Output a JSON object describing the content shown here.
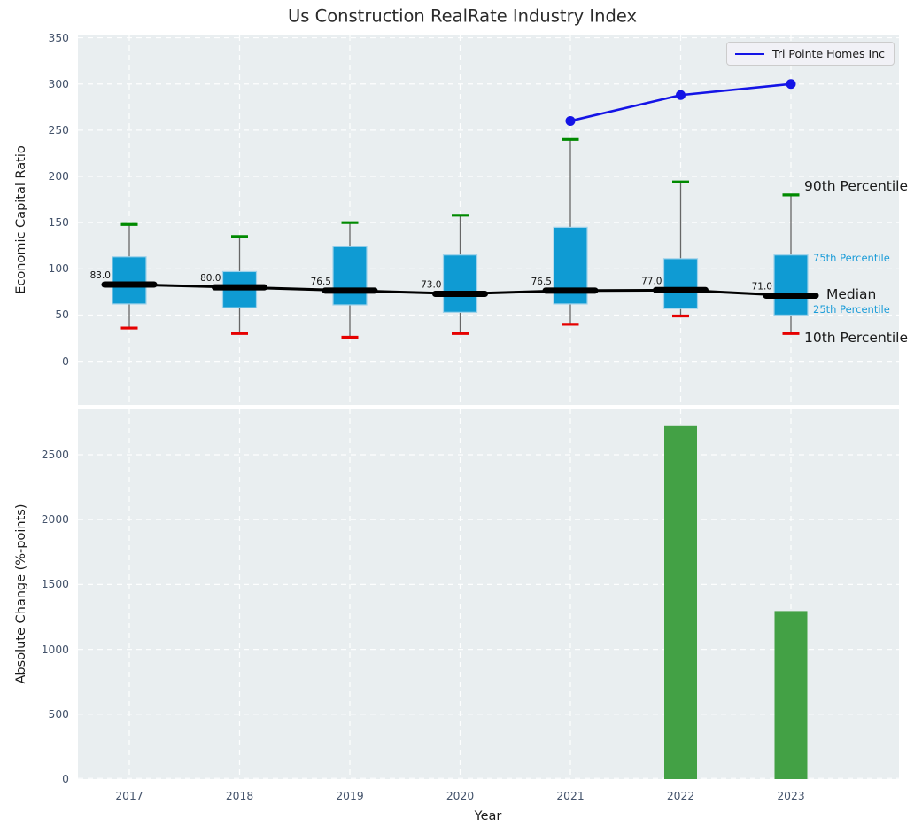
{
  "ui": {
    "title": "Us Construction RealRate Industry Index",
    "legend": {
      "label": "Tri Pointe Homes Inc"
    },
    "top_axis": {
      "ylabel": "Economic Capital Ratio"
    },
    "bottom_axis": {
      "ylabel": "Absolute Change (%-points)",
      "xlabel": "Year"
    },
    "annotations": {
      "p90": "90th Percentile",
      "p75": "75th Percentile",
      "median": "Median",
      "p25": "25th Percentile",
      "p10": "10th Percentile"
    }
  },
  "colors": {
    "plot_bg": "#e9eef0",
    "grid": "#ffffff",
    "box_fill": "#0f9bd3",
    "box_edge": "#9fd2ea",
    "whisker": "#666666",
    "cap_high": "#008a00",
    "cap_low": "#e60000",
    "median_line": "#000000",
    "company_line": "#1414e6",
    "bar_fill": "#43a145",
    "tick_text": "#44536b",
    "annotation_blue": "#1b9cd8"
  },
  "chart_data": [
    {
      "type": "boxplot",
      "title": "Us Construction RealRate Industry Index",
      "ylabel": "Economic Capital Ratio",
      "categories": [
        "2017",
        "2018",
        "2019",
        "2020",
        "2021",
        "2022",
        "2023"
      ],
      "ylim": [
        -47,
        352
      ],
      "yticks": [
        0,
        50,
        100,
        150,
        200,
        250,
        300,
        350
      ],
      "grid": true,
      "legend_position": "upper right",
      "boxes": [
        {
          "year": "2017",
          "p10": 36,
          "p25": 62,
          "median": 83.0,
          "p75": 113,
          "p90": 148,
          "median_label": "83.0"
        },
        {
          "year": "2018",
          "p10": 30,
          "p25": 58,
          "median": 80.0,
          "p75": 97,
          "p90": 135,
          "median_label": "80.0"
        },
        {
          "year": "2019",
          "p10": 26,
          "p25": 61,
          "median": 76.5,
          "p75": 124,
          "p90": 150,
          "median_label": "76.5"
        },
        {
          "year": "2020",
          "p10": 30,
          "p25": 53,
          "median": 73.0,
          "p75": 115,
          "p90": 158,
          "median_label": "73.0"
        },
        {
          "year": "2021",
          "p10": 40,
          "p25": 62,
          "median": 76.5,
          "p75": 145,
          "p90": 240,
          "median_label": "76.5"
        },
        {
          "year": "2022",
          "p10": 49,
          "p25": 57,
          "median": 77.0,
          "p75": 111,
          "p90": 194,
          "median_label": "77.0"
        },
        {
          "year": "2023",
          "p10": 30,
          "p25": 50,
          "median": 71.0,
          "p75": 115,
          "p90": 180,
          "median_label": "71.0"
        }
      ],
      "series": [
        {
          "name": "Tri Pointe Homes Inc",
          "x": [
            "2021",
            "2022",
            "2023"
          ],
          "values": [
            260,
            288,
            300
          ]
        }
      ]
    },
    {
      "type": "bar",
      "ylabel": "Absolute Change (%-points)",
      "xlabel": "Year",
      "categories": [
        "2017",
        "2018",
        "2019",
        "2020",
        "2021",
        "2022",
        "2023"
      ],
      "values": [
        null,
        null,
        null,
        null,
        null,
        2720,
        1295
      ],
      "ylim": [
        0,
        2855
      ],
      "yticks": [
        0,
        500,
        1000,
        1500,
        2000,
        2500
      ],
      "grid": true
    }
  ]
}
